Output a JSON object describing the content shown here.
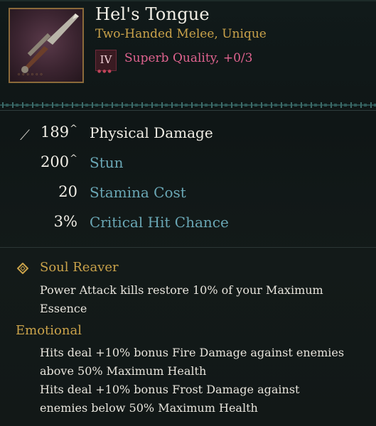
{
  "item": {
    "name": "Hel's Tongue",
    "type_line": "Two-Handed Melee, Unique",
    "tier": "IV",
    "quality": "Superb Quality, +0/3",
    "icon": "sword-icon"
  },
  "stats": [
    {
      "value": "189",
      "upgraded": true,
      "label": "Physical Damage",
      "icon": "sword-stat-icon"
    },
    {
      "value": "200",
      "upgraded": true,
      "label": "Stun"
    },
    {
      "value": "20",
      "upgraded": false,
      "label": "Stamina Cost"
    },
    {
      "value": "3%",
      "upgraded": false,
      "label": "Critical Hit Chance"
    }
  ],
  "perk": {
    "title": "Soul Reaver",
    "lines": [
      "Power Attack kills restore 10% of your Maximum",
      "Essence"
    ],
    "icon": "diamond-icon"
  },
  "emotional": {
    "title": "Emotional",
    "lines": [
      "Hits deal +10% bonus Fire Damage against enemies",
      "above 50% Maximum Health",
      "Hits deal +10% bonus Frost Damage against",
      "enemies below 50% Maximum Health"
    ]
  },
  "colors": {
    "gold": "#c9a24a",
    "teal": "#6aa7b5",
    "pink": "#e0638f"
  }
}
